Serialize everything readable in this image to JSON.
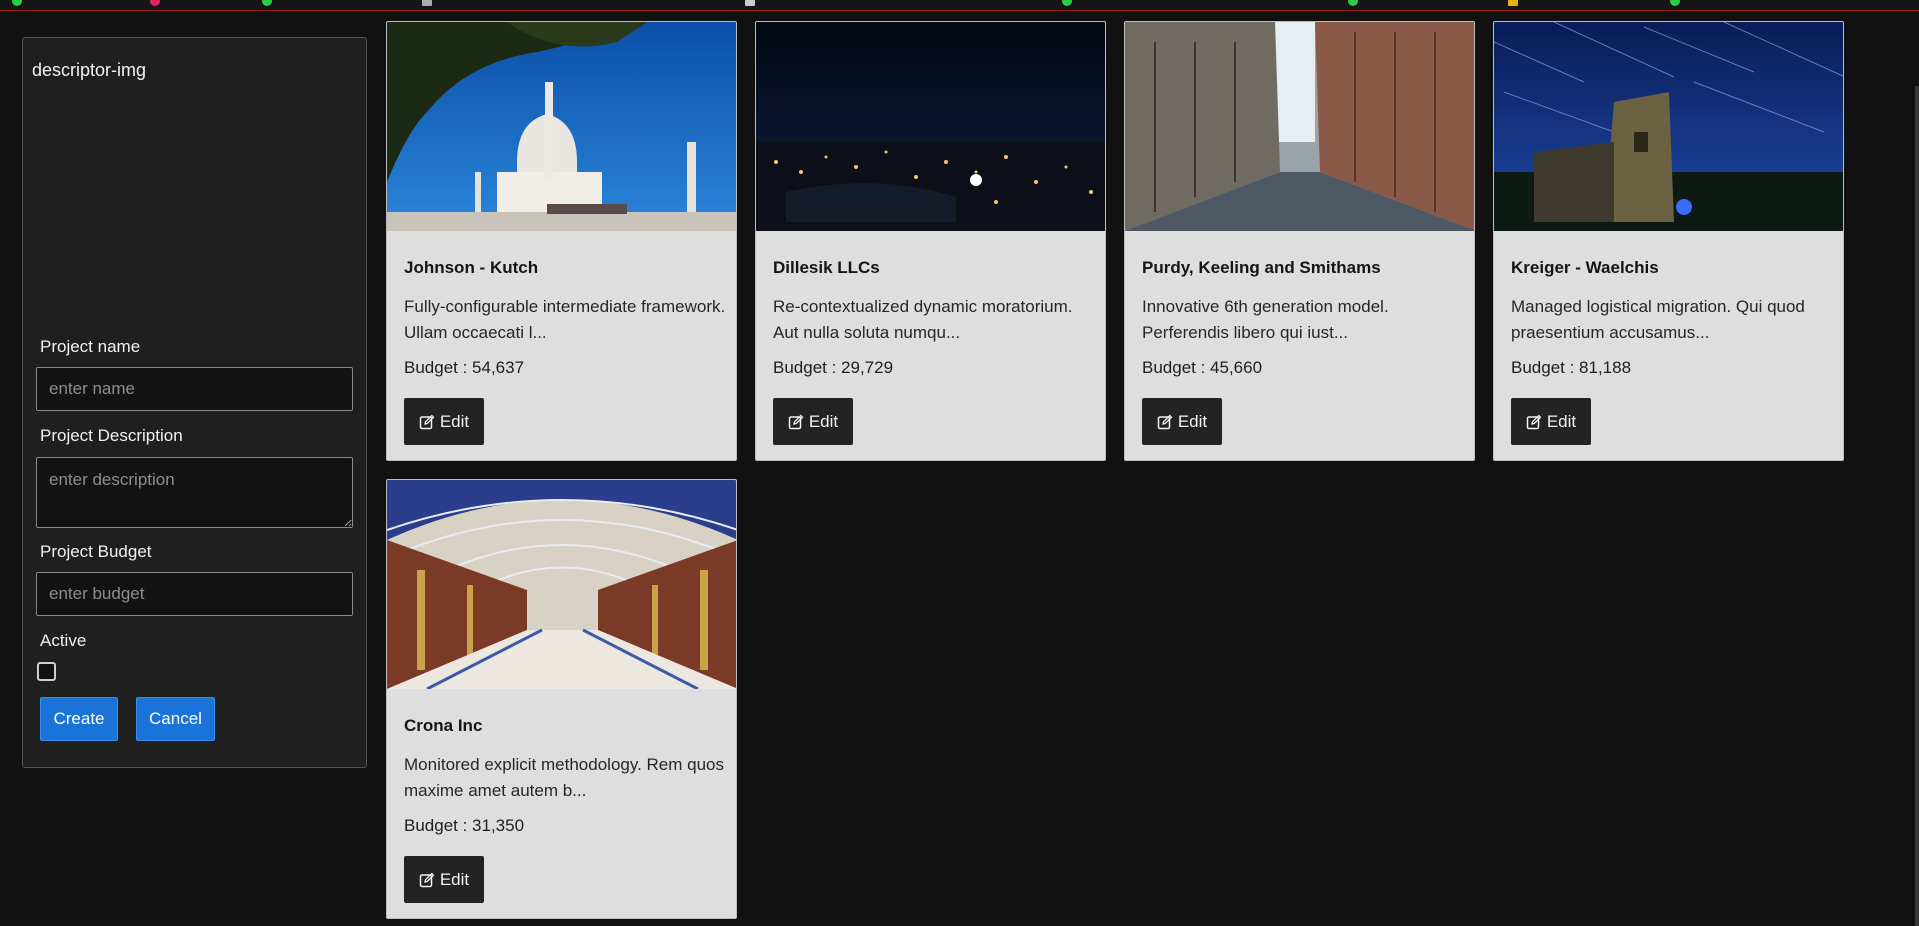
{
  "form": {
    "image_label": "descriptor-img",
    "name_label": "Project name",
    "name_placeholder": "enter name",
    "description_label": "Project Description",
    "description_placeholder": "enter description",
    "budget_label": "Project Budget",
    "budget_placeholder": "enter budget",
    "active_label": "Active",
    "active_checked": false,
    "create_label": "Create",
    "cancel_label": "Cancel"
  },
  "cards": [
    {
      "title": "Johnson - Kutch",
      "description": "Fully-configurable intermediate framework. Ullam occaecati l...",
      "budget": "Budget : 54,637",
      "edit_label": "Edit",
      "image": "taj-mahal-photo"
    },
    {
      "title": "Dillesik LLCs",
      "description": "Re-contextualized dynamic moratorium. Aut nulla soluta numqu...",
      "budget": "Budget : 29,729",
      "edit_label": "Edit",
      "image": "night-city-photo"
    },
    {
      "title": "Purdy, Keeling and Smithams",
      "description": "Innovative 6th generation model. Perferendis libero qui iust...",
      "budget": "Budget : 45,660",
      "edit_label": "Edit",
      "image": "city-street-photo"
    },
    {
      "title": "Kreiger - Waelchis",
      "description": "Managed logistical migration. Qui quod praesentium accusamus...",
      "budget": "Budget : 81,188",
      "edit_label": "Edit",
      "image": "star-trails-tower-photo"
    },
    {
      "title": "Crona Inc",
      "description": "Monitored explicit methodology. Rem quos maxime amet autem b...",
      "budget": "Budget : 31,350",
      "edit_label": "Edit",
      "image": "arcade-hall-photo"
    }
  ],
  "colors": {
    "background": "#111111",
    "panel": "#1f1f1f",
    "card": "#dedede",
    "primary_button": "#1a73d9",
    "edit_button": "#232323"
  },
  "icons": {
    "edit": "edit-square-icon"
  }
}
